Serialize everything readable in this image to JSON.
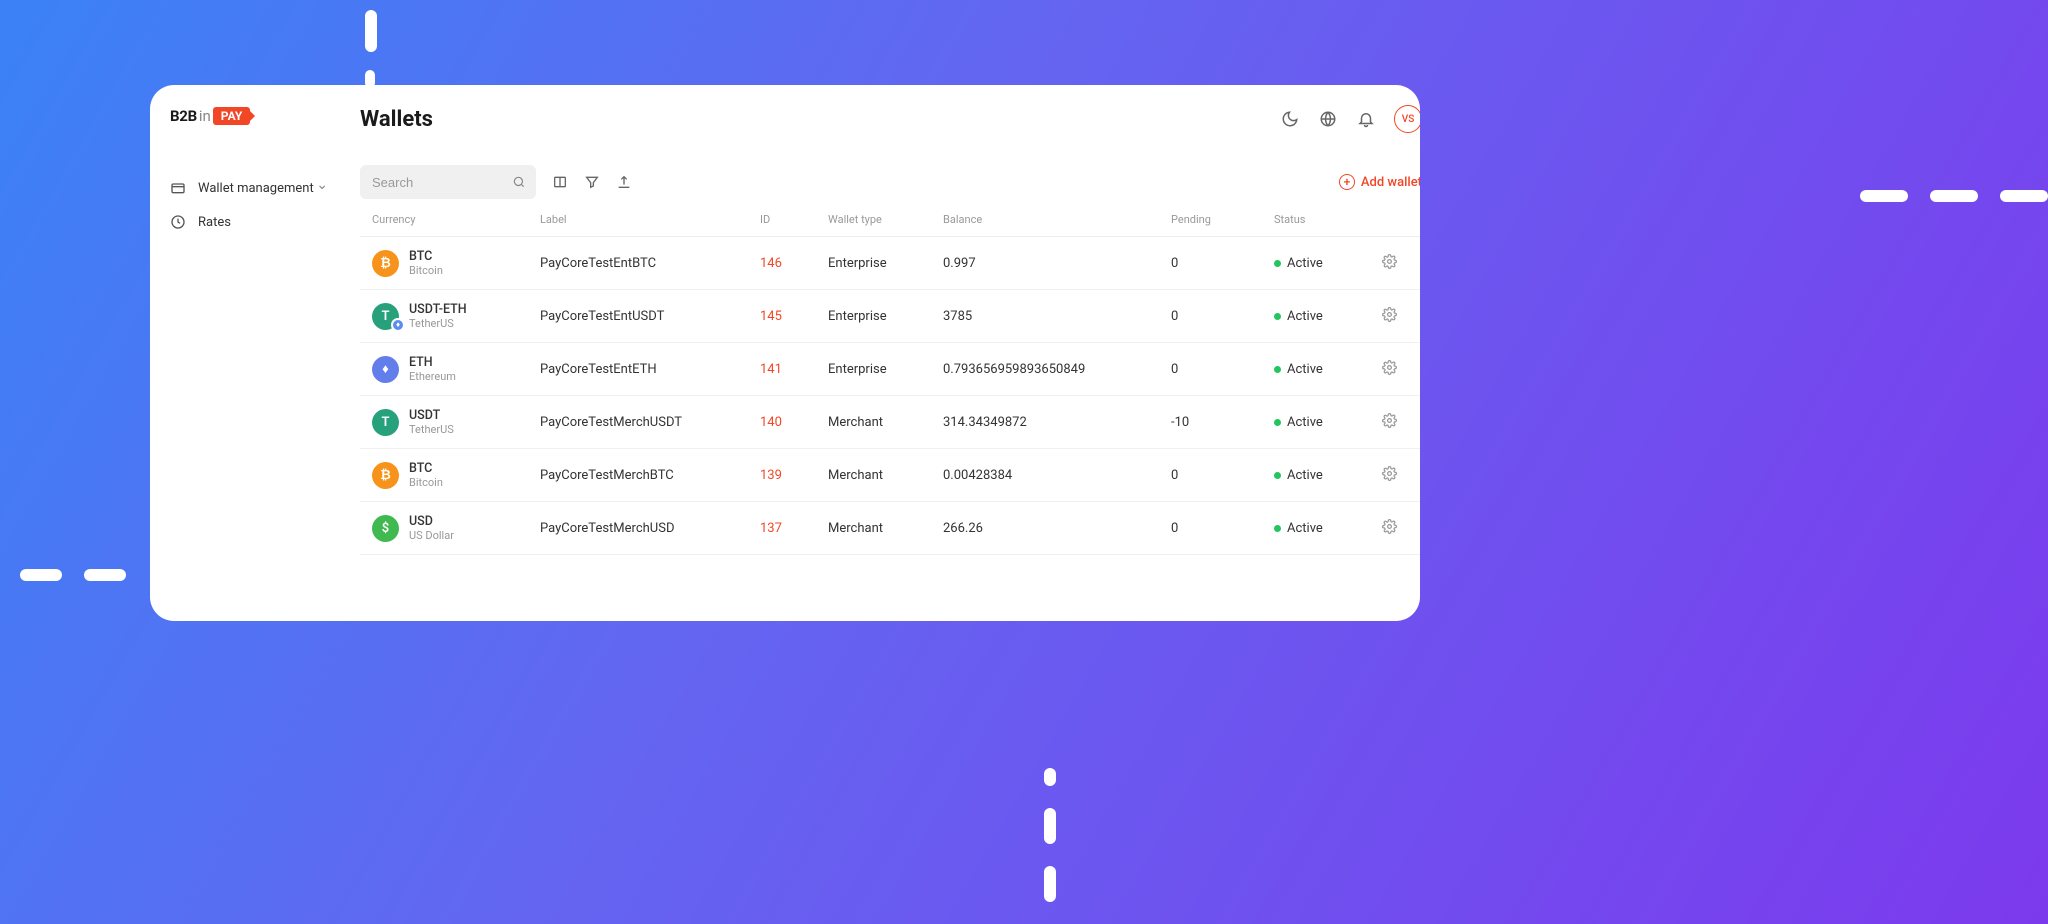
{
  "logo": {
    "b2b": "B2B",
    "in": "in",
    "pay": "PAY"
  },
  "sidebar": {
    "items": [
      {
        "label": "Wallet management"
      },
      {
        "label": "Rates"
      }
    ]
  },
  "header": {
    "title": "Wallets",
    "avatar": "VS"
  },
  "toolbar": {
    "search_placeholder": "Search",
    "add_wallet_label": "Add wallet"
  },
  "table": {
    "headers": {
      "currency": "Currency",
      "label": "Label",
      "id": "ID",
      "wallet_type": "Wallet type",
      "balance": "Balance",
      "pending": "Pending",
      "status": "Status"
    },
    "rows": [
      {
        "symbol": "BTC",
        "name": "Bitcoin",
        "iconText": "₿",
        "iconColor": "#f7931a",
        "badge": false,
        "label": "PayCoreTestEntBTC",
        "id": "146",
        "type": "Enterprise",
        "balance": "0.997",
        "pending": "0",
        "status": "Active"
      },
      {
        "symbol": "USDT-ETH",
        "name": "TetherUS",
        "iconText": "T",
        "iconColor": "#26a17b",
        "badge": true,
        "label": "PayCoreTestEntUSDT",
        "id": "145",
        "type": "Enterprise",
        "balance": "3785",
        "pending": "0",
        "status": "Active"
      },
      {
        "symbol": "ETH",
        "name": "Ethereum",
        "iconText": "♦",
        "iconColor": "#627eea",
        "badge": false,
        "label": "PayCoreTestEntETH",
        "id": "141",
        "type": "Enterprise",
        "balance": "0.793656959893650849",
        "pending": "0",
        "status": "Active"
      },
      {
        "symbol": "USDT",
        "name": "TetherUS",
        "iconText": "T",
        "iconColor": "#26a17b",
        "badge": false,
        "label": "PayCoreTestMerchUSDT",
        "id": "140",
        "type": "Merchant",
        "balance": "314.34349872",
        "pending": "-10",
        "status": "Active"
      },
      {
        "symbol": "BTC",
        "name": "Bitcoin",
        "iconText": "₿",
        "iconColor": "#f7931a",
        "badge": false,
        "label": "PayCoreTestMerchBTC",
        "id": "139",
        "type": "Merchant",
        "balance": "0.00428384",
        "pending": "0",
        "status": "Active"
      },
      {
        "symbol": "USD",
        "name": "US Dollar",
        "iconText": "$",
        "iconColor": "#3fb950",
        "badge": false,
        "label": "PayCoreTestMerchUSD",
        "id": "137",
        "type": "Merchant",
        "balance": "266.26",
        "pending": "0",
        "status": "Active"
      }
    ]
  }
}
